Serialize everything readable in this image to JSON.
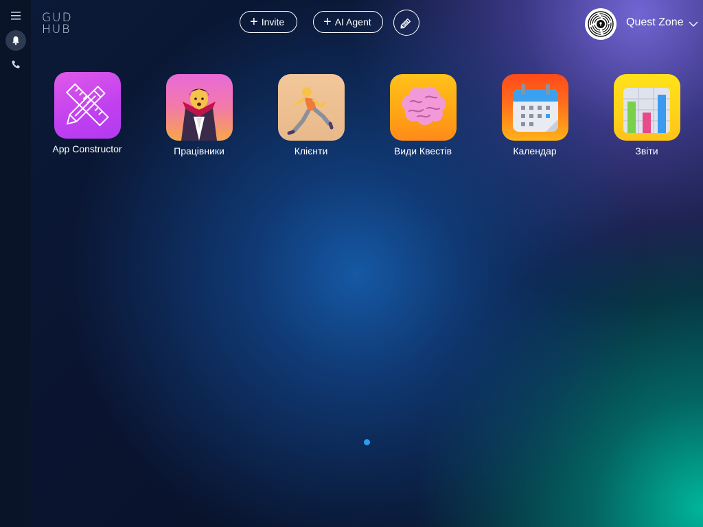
{
  "logo": {
    "line1": "GUD",
    "line2": "HUB"
  },
  "sidebar": {
    "items": [
      {
        "icon": "menu-icon"
      },
      {
        "icon": "bell-icon"
      },
      {
        "icon": "phone-icon"
      }
    ]
  },
  "header": {
    "invite_label": "Invite",
    "agent_label": "AI Agent",
    "plus": "+",
    "user_name": "Quest Zone"
  },
  "apps": [
    {
      "label": "App Constructor",
      "icon": "pencil-ruler-icon"
    },
    {
      "label": "Працівники",
      "icon": "vampire-icon"
    },
    {
      "label": "Клієнти",
      "icon": "runner-icon"
    },
    {
      "label": "Види Квестів",
      "icon": "brain-icon"
    },
    {
      "label": "Календар",
      "icon": "calendar-icon"
    },
    {
      "label": "Звіти",
      "icon": "bar-chart-icon"
    }
  ],
  "colors": {
    "accent": "#2a9df4",
    "sidebar_bg": "#0a1428"
  }
}
